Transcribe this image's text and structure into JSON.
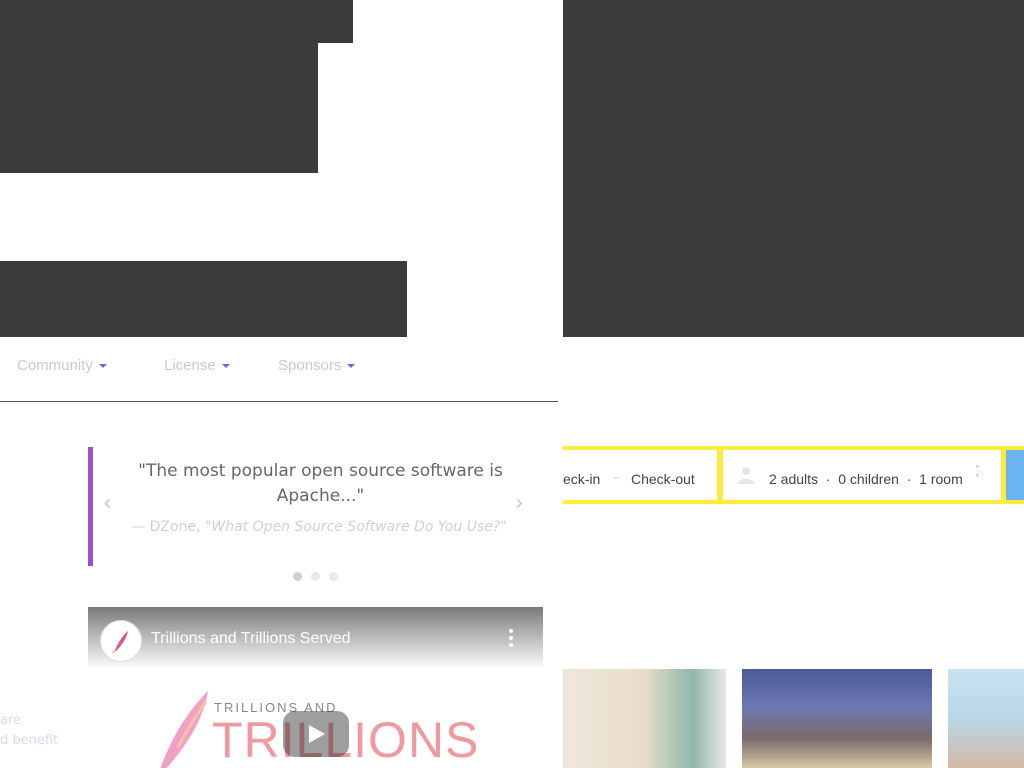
{
  "nav": {
    "items": [
      {
        "label": "Community"
      },
      {
        "label": "License"
      },
      {
        "label": "Sponsors"
      }
    ]
  },
  "testimonial": {
    "quote": "\"The most popular open source software is Apache...\"",
    "cite_prefix": "— DZone, ",
    "cite_title": "\"What Open Source Software Do You Use?\""
  },
  "video": {
    "title": "Trillions and Trillions Served",
    "logo_small": "TRILLIONS AND",
    "logo_big": "TRILLIONS"
  },
  "side_text": {
    "line1": "are",
    "line2": "d benefit"
  },
  "booking": {
    "checkin": "eck-in",
    "separator": "–",
    "checkout": "Check-out",
    "guests": "2 adults  ·  0 children  ·  1 room"
  },
  "colors": {
    "dark_block": "#3b3b3b",
    "quote_border": "#9b4fc9",
    "booking_bar": "#ffeb3b",
    "search_button": "#6ab4f0"
  },
  "icons": [
    "caret-down-icon",
    "chevron-left-icon",
    "chevron-right-icon",
    "feather-icon",
    "play-icon",
    "more-vertical-icon",
    "person-icon",
    "chevron-up-down-icon"
  ]
}
